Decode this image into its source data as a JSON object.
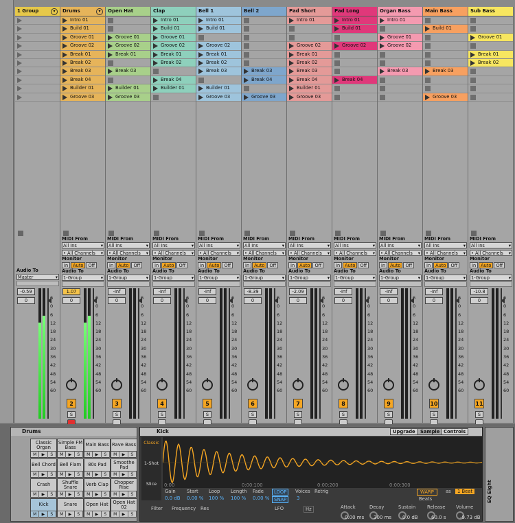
{
  "tracks": [
    {
      "name": "1 Group",
      "color": "#e6c84a",
      "group": true,
      "clips": [],
      "vol": "-0.59",
      "pan": "0",
      "num": "",
      "audio_to": "Master"
    },
    {
      "name": "Drums",
      "color": "#e6b45a",
      "clips": [
        "Intro 01",
        "Build 01",
        "Groove 01",
        "Groove 02",
        "Break 01",
        "Break 02",
        "Break 03",
        "Break 04",
        "Builder 01",
        "Groove 03"
      ],
      "vol": "1.07",
      "pan": "0",
      "num": "2",
      "audio_to": "1-Group"
    },
    {
      "name": "Open Hat",
      "color": "#a8d08a",
      "clips": [
        "",
        "",
        "Groove 01",
        "Groove 02",
        "Break 01",
        "",
        "Break 03",
        "",
        "Builder 01",
        "Groove 03"
      ],
      "vol": "-Inf",
      "pan": "0",
      "num": "3",
      "audio_to": "1-Group"
    },
    {
      "name": "Clap",
      "color": "#8ed0bc",
      "clips": [
        "Intro 01",
        "Build 01",
        "Groove 01",
        "Groove 02",
        "Break 01",
        "Break 02",
        "",
        "Break 04",
        "Builder 01",
        ""
      ],
      "vol": "-Inf",
      "pan": "0",
      "num": "4",
      "audio_to": "1-Group"
    },
    {
      "name": "Bell 1",
      "color": "#9ec4dc",
      "clips": [
        "Intro 01",
        "Build 01",
        "",
        "Groove 02",
        "Break 01",
        "Break 02",
        "Break 03",
        "",
        "Builder 01",
        "Groove 03"
      ],
      "vol": "-Inf",
      "pan": "0",
      "num": "5",
      "audio_to": "1-Group"
    },
    {
      "name": "Bell 2",
      "color": "#7ea6cc",
      "clips": [
        "",
        "",
        "",
        "",
        "",
        "",
        "Break 03",
        "Break 04",
        "",
        "Groove 03"
      ],
      "vol": "-8.39",
      "pan": "0",
      "num": "6",
      "audio_to": "1-Group"
    },
    {
      "name": "Pad Short",
      "color": "#e49a98",
      "clips": [
        "Intro 01",
        "",
        "",
        "Groove 02",
        "Break 01",
        "Break 02",
        "Break 03",
        "Break 04",
        "Builder 01",
        "Groove 03"
      ],
      "vol": "-2.09",
      "pan": "0",
      "num": "7",
      "audio_to": "1-Group"
    },
    {
      "name": "Pad Long",
      "color": "#e0387a",
      "clips": [
        "Intro 01",
        "Build 01",
        "",
        "Groove 02",
        "",
        "",
        "",
        "Break 04",
        "",
        ""
      ],
      "vol": "-Inf",
      "pan": "0",
      "num": "8",
      "audio_to": "1-Group"
    },
    {
      "name": "Organ Bass",
      "color": "#f49ab0",
      "clips": [
        "Intro 01",
        "",
        "Groove 01",
        "Groove 02",
        "",
        "",
        "Break 03",
        "",
        "",
        ""
      ],
      "vol": "-Inf",
      "pan": "0",
      "num": "9",
      "audio_to": "1-Group"
    },
    {
      "name": "Main Bass",
      "color": "#f7a060",
      "clips": [
        "",
        "Build 01",
        "",
        "",
        "",
        "",
        "Break 03",
        "",
        "",
        "Groove 03"
      ],
      "vol": "-Inf",
      "pan": "0",
      "num": "10",
      "audio_to": "1-Group"
    },
    {
      "name": "Sub Bass",
      "color": "#f7e660",
      "clips": [
        "",
        "",
        "Groove 01",
        "",
        "Break 01",
        "Break 02",
        "",
        "",
        "",
        ""
      ],
      "vol": "-10.8",
      "pan": "0",
      "num": "11",
      "audio_to": "1-Group"
    }
  ],
  "io": {
    "midi_from": "MIDI From",
    "all_ins": "All Ins",
    "all_channels": "• All Channels",
    "monitor": "Monitor",
    "in": "In",
    "auto": "Auto",
    "off": "Off",
    "audio_to": "Audio To"
  },
  "scale": [
    "6",
    "0",
    "6",
    "12",
    "18",
    "24",
    "30",
    "36",
    "42",
    "48",
    "54",
    "60"
  ],
  "rack": {
    "title": "Drums",
    "pads": [
      [
        "Classic Organ",
        "Simple FM Bass",
        "Main Bass",
        "Rave Bass"
      ],
      [
        "Bell Chord",
        "Bell Flam",
        "80s Pad",
        "Smoothe Pad"
      ],
      [
        "Crash",
        "Shuffle Snare",
        "Verb Clap",
        "Chopper Rise"
      ],
      [
        "Kick",
        "Snare",
        "Open Hat",
        "Open Hat 02"
      ]
    ]
  },
  "simpler": {
    "title": "Kick",
    "sample": "Sample",
    "controls": "Controls",
    "upgrade": "Upgrade",
    "modes": [
      "Classic",
      "1-Shot",
      "Slice"
    ],
    "times": [
      "0:00",
      "0:00:100",
      "0:00:200",
      "0:00:300"
    ],
    "params": [
      [
        "Gain",
        "0.0 dB"
      ],
      [
        "Start",
        "0.00 %"
      ],
      [
        "Loop",
        "100 %"
      ],
      [
        "Length",
        "100 %"
      ],
      [
        "Fade",
        "0.00 %"
      ]
    ],
    "loop": "LOOP",
    "snap": "SNAP",
    "voices_label": "Voices",
    "voices": "3",
    "retrig": "Retrig",
    "warp": "WARP",
    "as": "as",
    "beat": "1 Beat",
    "beats": "Beats",
    "filter": "Filter",
    "frequency": "Frequency",
    "res": "Res",
    "lfo": "LFO",
    "hz": "Hz",
    "env": [
      [
        "Attack",
        "0.00 ms"
      ],
      [
        "Decay",
        "300 ms"
      ],
      [
        "Sustain",
        "0.0 dB"
      ],
      [
        "Release",
        "60.0 s"
      ],
      [
        "Volume",
        "-9.73 dB"
      ]
    ]
  },
  "eq": "EQ Eight"
}
